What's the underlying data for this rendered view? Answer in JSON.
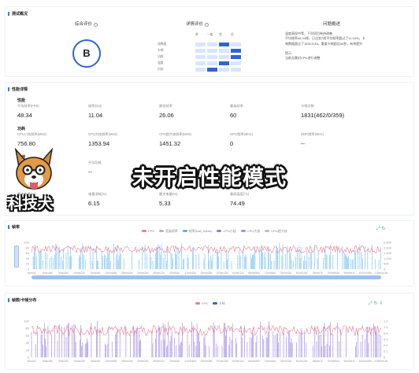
{
  "summary": {
    "title": "测试概况",
    "overall_label": "综合评价",
    "grade": "B",
    "detail_label": "详情评价",
    "issue_label": "问题概述",
    "rating_scale": [
      "差",
      "一般",
      "良",
      "优"
    ],
    "rating_rows": [
      {
        "label": "流畅度",
        "level": 2
      },
      {
        "label": "卡顿",
        "level": 3
      },
      {
        "label": "功耗",
        "level": 3
      },
      {
        "label": "温度",
        "level": 2
      },
      {
        "label": "内存",
        "level": 1
      }
    ],
    "issue_lines": [
      "温度表现中等，下列项目有待改善",
      "平均帧率48.34帧，已达到7成平均帧率超过了11.04%，卡",
      "顿数据超过了1831/2/45，重度卡顿超过60秒，有待提升",
      "",
      "提示:",
      "当前无需对CPU进行调整"
    ]
  },
  "performance": {
    "title": "性能详情",
    "groups": [
      {
        "name": "性能",
        "metrics": [
          {
            "label": "平均帧率(FPS)",
            "value": "48.34"
          },
          {
            "label": "帧率抖动",
            "value": "11.04"
          },
          {
            "label": "最低帧率",
            "value": "26.06"
          },
          {
            "label": "最高帧率",
            "value": "60"
          },
          {
            "label": "卡顿次数",
            "value": "1831(462/0/359)"
          }
        ]
      },
      {
        "name": "功耗",
        "metrics": [
          {
            "label": "CPU小核频率(MHz)",
            "value": "756.80"
          },
          {
            "label": "CPU大核频率(MHz)",
            "value": "1353.94"
          },
          {
            "label": "CPU超大核频率(MHz)",
            "value": "1451.32"
          },
          {
            "label": "GPU频率(MHz)",
            "value": "0"
          },
          {
            "label": "DDR频率(MHz)",
            "value": "--"
          }
        ]
      },
      {
        "name": "其他",
        "metrics": [
          {
            "label": "平均内存(MB)",
            "value": "--"
          },
          {
            "label": "平均功耗",
            "value": "--"
          }
        ]
      },
      {
        "name": "",
        "metrics": [
          {
            "label": "最大电量(%)",
            "value": "43.69"
          },
          {
            "label": "电量消耗(%)",
            "value": "6.15"
          },
          {
            "label": "最大电量(%)",
            "value": "5.33"
          },
          {
            "label": "最高温度(°C)",
            "value": "74.49"
          }
        ]
      }
    ]
  },
  "chart1": {
    "title": "帧率",
    "legend": [
      "FPS",
      "渲染帧率",
      "帧率(half_frame)",
      "CPU小核",
      "CPU大核",
      "CPU超大核"
    ],
    "legend_colors": [
      "#e8808f",
      "#aab6c8",
      "#5bb6ef",
      "#7d8fb3",
      "#8ea3d6",
      "#b7c1cf"
    ],
    "y_left": [
      "100",
      "80",
      "60",
      "40",
      "20",
      "0"
    ],
    "y_right": [
      "2,500",
      "2,000",
      "1,500",
      "1,000",
      "500",
      "0"
    ],
    "x_labels": [
      "0min2s",
      "4min48s",
      "9min35s",
      "14min22s",
      "19min9s",
      "23min56s",
      "28min43s",
      "33min30s",
      "38min17s",
      "43min4s",
      "47min51s",
      "52min38s",
      "57min25s",
      "62min12s",
      "66min59s",
      "71min46s",
      "76min33s",
      "81min20s",
      "86min7s",
      "90min54s",
      "95min41s",
      "100min28s",
      "105min15s"
    ]
  },
  "chart2": {
    "title": "帧数/卡顿分布",
    "legend": [
      "FPS",
      "卡顿"
    ],
    "legend_colors": [
      "#e8808f",
      "#2f64d8"
    ],
    "y_left": [
      "100",
      "80",
      "60",
      "40",
      "20",
      "0"
    ],
    "y_right": [
      "1.2",
      "1.0",
      "0.8",
      "0.6",
      "0.4",
      "0.2",
      "0"
    ],
    "x_labels": [
      "0min2s",
      "4min48s",
      "9min35s",
      "14min22s",
      "19min9s",
      "23min56s",
      "28min43s",
      "33min30s",
      "38min17s",
      "43min4s",
      "47min51s",
      "52min38s",
      "57min25s",
      "62min12s",
      "66min59s",
      "71min46s",
      "76min33s",
      "81min20s",
      "86min7s",
      "90min54s",
      "95min41s",
      "100min28s",
      "105min15s"
    ]
  },
  "overlay": {
    "caption": "未开启性能模式",
    "watermark": "科技犬"
  }
}
